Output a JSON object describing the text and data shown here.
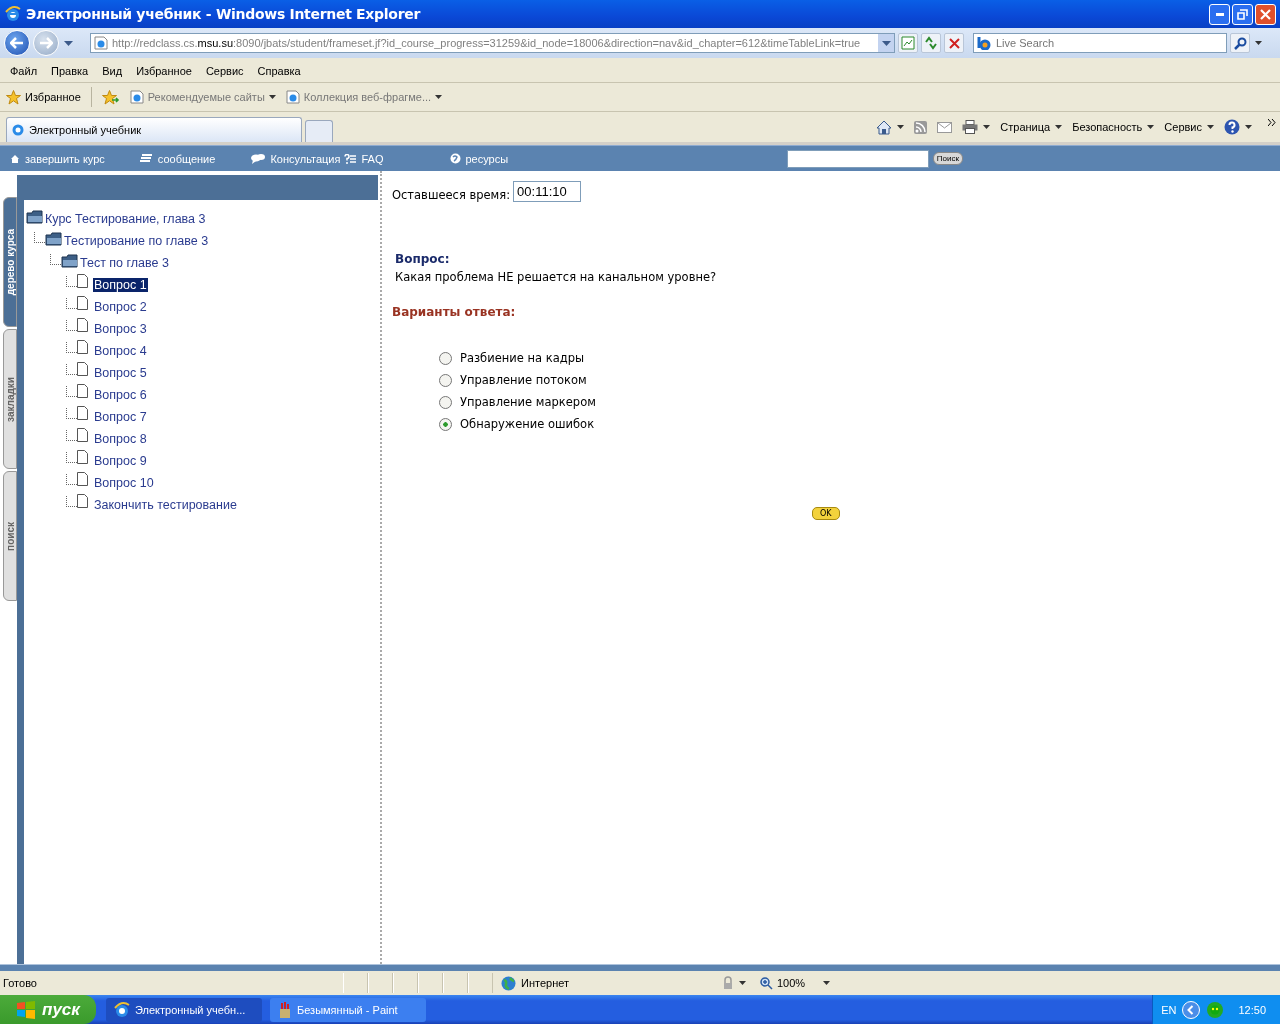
{
  "window": {
    "title": "Электронный учебник - Windows Internet Explorer"
  },
  "address_bar": {
    "url_start": "http://redclass.cs.",
    "url_host": "msu.su",
    "url_rest": ":8090/jbats/student/frameset.jf?id_course_progress=31259&id_node=18006&direction=nav&id_chapter=612&timeTableLink=true"
  },
  "search": {
    "placeholder": "Live Search"
  },
  "menu": [
    "Файл",
    "Правка",
    "Вид",
    "Избранное",
    "Сервис",
    "Справка"
  ],
  "favorites_bar": {
    "favorites": "Избранное",
    "links": [
      "Рекомендуемые сайты",
      "Коллекция веб-фрагме..."
    ]
  },
  "tabs": [
    {
      "label": "Электронный учебник",
      "selected": true
    }
  ],
  "command_bar": [
    "Страница",
    "Безопасность",
    "Сервис"
  ],
  "site_nav": [
    {
      "kind": "home",
      "label": "завершить курс"
    },
    {
      "kind": "message",
      "label": "сообщение"
    },
    {
      "kind": "chat",
      "label": "Консультация"
    },
    {
      "kind": "faq",
      "label": "FAQ"
    },
    {
      "kind": "resources",
      "label": "ресурсы"
    }
  ],
  "site_search": {
    "button": "Поиск"
  },
  "side_tabs": [
    {
      "label": "дерево курса",
      "selected": true
    },
    {
      "label": "закладки",
      "selected": false
    },
    {
      "label": "поиск",
      "selected": false
    }
  ],
  "tree": [
    {
      "kind": "folder",
      "label": "Курс Тестирование, глава 3",
      "selected": false,
      "children": [
        {
          "kind": "folder",
          "label": "Тестирование по главе 3",
          "selected": false,
          "children": [
            {
              "kind": "folder",
              "label": "Тест по главе 3",
              "selected": false,
              "children": [
                {
                  "kind": "page",
                  "label": "Вопрос 1",
                  "selected": true
                },
                {
                  "kind": "page",
                  "label": "Вопрос 2",
                  "selected": false
                },
                {
                  "kind": "page",
                  "label": "Вопрос 3",
                  "selected": false
                },
                {
                  "kind": "page",
                  "label": "Вопрос 4",
                  "selected": false
                },
                {
                  "kind": "page",
                  "label": "Вопрос 5",
                  "selected": false
                },
                {
                  "kind": "page",
                  "label": "Вопрос 6",
                  "selected": false
                },
                {
                  "kind": "page",
                  "label": "Вопрос 7",
                  "selected": false
                },
                {
                  "kind": "page",
                  "label": "Вопрос 8",
                  "selected": false
                },
                {
                  "kind": "page",
                  "label": "Вопрос 9",
                  "selected": false
                },
                {
                  "kind": "page",
                  "label": "Вопрос 10",
                  "selected": false
                },
                {
                  "kind": "page",
                  "label": "Закончить тестирование",
                  "selected": false
                }
              ]
            }
          ]
        }
      ]
    }
  ],
  "timer": {
    "label": "Оставшееся время:",
    "value": "00:11:10"
  },
  "question": {
    "label": "Вопрос:",
    "text": "Какая проблема НЕ решается на канальном уровне?"
  },
  "answers": {
    "label": "Варианты ответа:",
    "options": [
      {
        "label": "Разбиение на кадры",
        "selected": false
      },
      {
        "label": "Управление потоком",
        "selected": false
      },
      {
        "label": "Управление маркером",
        "selected": false
      },
      {
        "label": "Обнаружение ошибок",
        "selected": true
      }
    ]
  },
  "ok_button": "OK",
  "status_bar": {
    "text": "Готово",
    "zone": "Интернет",
    "zoom": "100%"
  },
  "taskbar": {
    "start": "пуск",
    "tasks": [
      {
        "label": "Электронный учебн...",
        "selected": true
      },
      {
        "label": "Безымянный - Paint",
        "selected": false
      }
    ],
    "language": "EN",
    "clock": "12:50"
  }
}
